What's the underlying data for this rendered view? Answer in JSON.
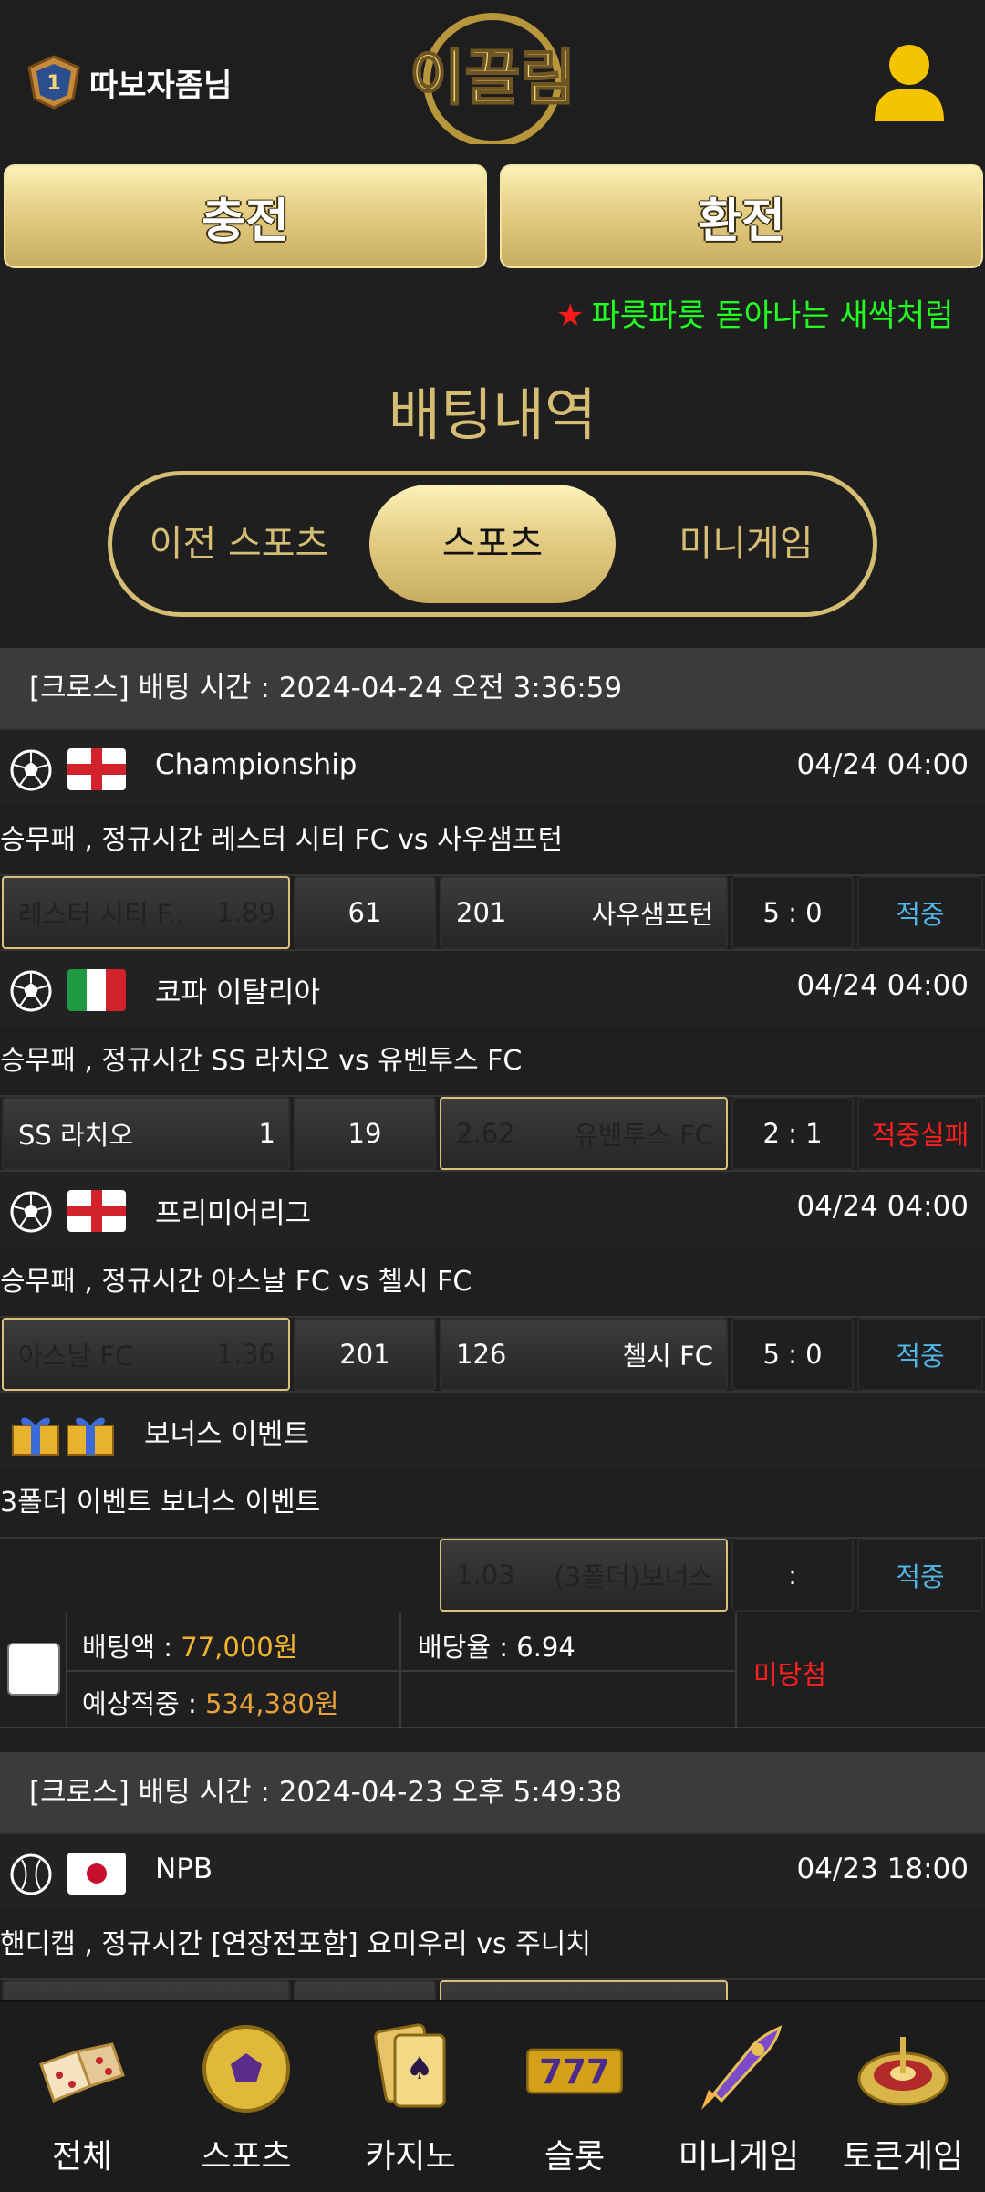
{
  "header": {
    "user_name": "따보자좀님",
    "logo_text": "이끌림",
    "charge_label": "충전",
    "withdraw_label": "환전",
    "marquee": "파릇파릇 돋아나는 새싹처럼"
  },
  "page": {
    "title": "배팅내역",
    "tabs": [
      "이전 스포츠",
      "스포츠",
      "미니게임"
    ]
  },
  "bets": [
    {
      "header": "[크로스] 배팅 시간 : 2024-04-24 오전 3:36:59",
      "matches": [
        {
          "sport": "soccer-icon",
          "flag": "england-flag",
          "league": "Championship",
          "time": "04/24 04:00",
          "desc": "승무패 , 정규시간 레스터 시티 FC  vs  사우샘프턴",
          "home": "레스터 시티 F..",
          "home_odds": "1.89",
          "draw": "61",
          "away_odds": "201",
          "away": "사우샘프턴",
          "score": "5 : 0",
          "result": "적중"
        },
        {
          "sport": "soccer-icon",
          "flag": "italy-flag",
          "league": "코파 이탈리아",
          "time": "04/24 04:00",
          "desc": "승무패 , 정규시간 SS 라치오  vs  유벤투스 FC",
          "home": "SS 라치오",
          "home_odds": "1",
          "draw": "19",
          "away_odds": "2.62",
          "away": "유벤투스 FC",
          "score": "2 : 1",
          "result": "적중실패"
        },
        {
          "sport": "soccer-icon",
          "flag": "england-flag",
          "league": "프리미어리그",
          "time": "04/24 04:00",
          "desc": "승무패 , 정규시간 아스날 FC  vs  첼시 FC",
          "home": "아스날 FC",
          "home_odds": "1.36",
          "draw": "201",
          "away_odds": "126",
          "away": "첼시 FC",
          "score": "5 : 0",
          "result": "적중"
        },
        {
          "sport": "gift-icon",
          "league": "보너스 이벤트",
          "desc": "3폴더 이벤트 보너스 이벤트",
          "away_odds": "1.03",
          "away": "(3폴더)보너스",
          "score": ":",
          "result": "적중"
        }
      ],
      "summary": {
        "bet_label": "배팅액 : ",
        "bet_value": "77,000원",
        "rate_label": "배당율 : ",
        "rate_value": "6.94",
        "expected_label": "예상적중 : ",
        "expected_value": "534,380원",
        "status": "미당첨"
      }
    },
    {
      "header": "[크로스] 배팅 시간 : 2024-04-23 오후 5:49:38",
      "matches": [
        {
          "sport": "baseball-icon",
          "flag": "japan-flag",
          "league": "NPB",
          "time": "04/23 18:00",
          "desc": "핸디캡 , 정규시간 [연장전포함] 요미우리  vs  주니치"
        }
      ]
    }
  ],
  "nav": [
    {
      "label": "전체",
      "icon": "dice-icon"
    },
    {
      "label": "스포츠",
      "icon": "sports-ball-icon"
    },
    {
      "label": "카지노",
      "icon": "casino-cards-icon"
    },
    {
      "label": "슬롯",
      "icon": "slot-777-icon"
    },
    {
      "label": "미니게임",
      "icon": "rocket-icon"
    },
    {
      "label": "토큰게임",
      "icon": "roulette-icon"
    }
  ],
  "colors": {
    "gold": "#d6bd74",
    "hit": "#4fb6e6",
    "miss": "#ff1f1f",
    "marquee": "#22ff22"
  }
}
